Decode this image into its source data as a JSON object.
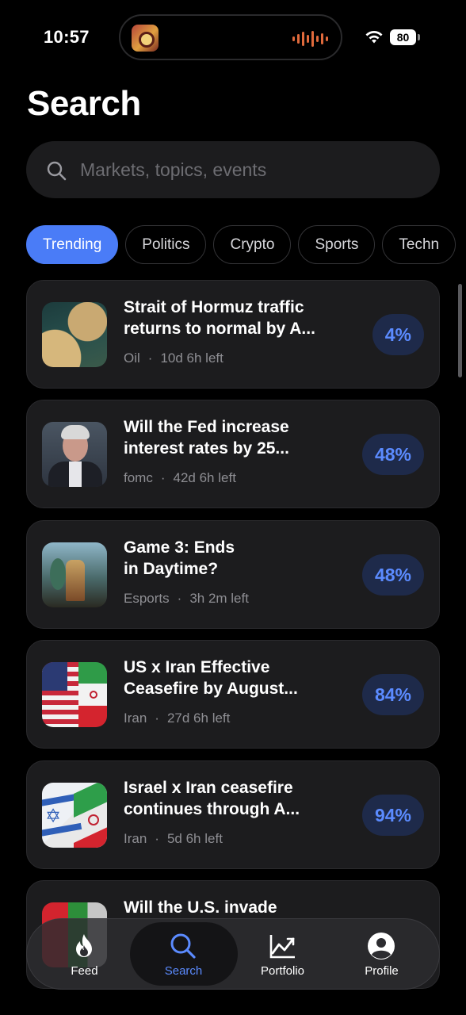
{
  "status_bar": {
    "time": "10:57",
    "battery": "80"
  },
  "page": {
    "title": "Search"
  },
  "search": {
    "placeholder": "Markets, topics, events",
    "value": ""
  },
  "chips": [
    {
      "label": "Trending",
      "active": true
    },
    {
      "label": "Politics",
      "active": false
    },
    {
      "label": "Crypto",
      "active": false
    },
    {
      "label": "Sports",
      "active": false
    },
    {
      "label": "Techn",
      "active": false
    }
  ],
  "markets": [
    {
      "title_line1": "Strait of Hormuz traffic",
      "title_line2": "returns to normal by A...",
      "category": "Oil",
      "time_left": "10d 6h left",
      "percent": "4%"
    },
    {
      "title_line1": "Will the Fed increase",
      "title_line2": "interest rates by 25...",
      "category": "fomc",
      "time_left": "42d 6h left",
      "percent": "48%"
    },
    {
      "title_line1": "Game 3: Ends",
      "title_line2": "in Daytime?",
      "category": "Esports",
      "time_left": "3h 2m left",
      "percent": "48%"
    },
    {
      "title_line1": "US x Iran Effective",
      "title_line2": "Ceasefire by August...",
      "category": "Iran",
      "time_left": "27d 6h left",
      "percent": "84%"
    },
    {
      "title_line1": "Israel x Iran ceasefire",
      "title_line2": "continues through A...",
      "category": "Iran",
      "time_left": "5d 6h left",
      "percent": "94%"
    },
    {
      "title_line1": "Will the U.S. invade",
      "title_line2": "",
      "category": "",
      "time_left": "",
      "percent": ""
    }
  ],
  "tabs": [
    {
      "label": "Feed",
      "icon": "flame-icon",
      "active": false
    },
    {
      "label": "Search",
      "icon": "search-icon",
      "active": true
    },
    {
      "label": "Portfolio",
      "icon": "chart-line-icon",
      "active": false
    },
    {
      "label": "Profile",
      "icon": "person-icon",
      "active": false
    }
  ],
  "colors": {
    "accent": "#4a7cf7",
    "background": "#000000",
    "card": "#1c1c1e",
    "percent_text": "#5b8bff",
    "percent_bg": "#1e2a4a"
  }
}
